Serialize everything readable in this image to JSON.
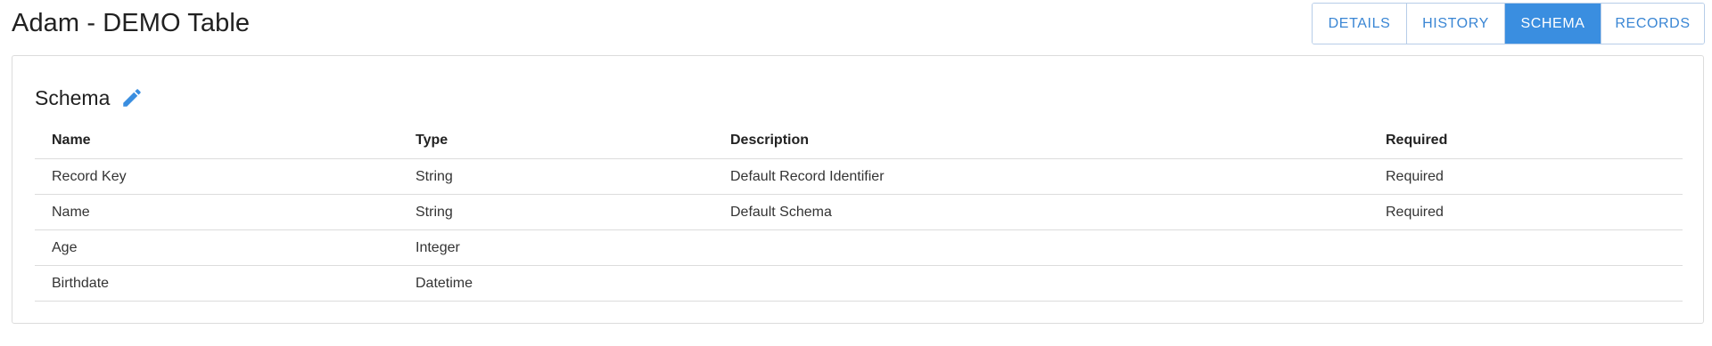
{
  "header": {
    "title": "Adam - DEMO Table",
    "tabs": [
      {
        "label": "DETAILS",
        "active": false
      },
      {
        "label": "HISTORY",
        "active": false
      },
      {
        "label": "SCHEMA",
        "active": true
      },
      {
        "label": "RECORDS",
        "active": false
      }
    ]
  },
  "schema": {
    "title": "Schema",
    "edit_icon": "pencil-icon",
    "columns": [
      "Name",
      "Type",
      "Description",
      "Required"
    ],
    "rows": [
      {
        "name": "Record Key",
        "type": "String",
        "description": "Default Record Identifier",
        "required": "Required"
      },
      {
        "name": "Name",
        "type": "String",
        "description": "Default Schema",
        "required": "Required"
      },
      {
        "name": "Age",
        "type": "Integer",
        "description": "",
        "required": ""
      },
      {
        "name": "Birthdate",
        "type": "Datetime",
        "description": "",
        "required": ""
      }
    ]
  },
  "colors": {
    "accent": "#3a8ee0",
    "tab_text": "#3a86d4",
    "border": "#dcdcdc"
  }
}
